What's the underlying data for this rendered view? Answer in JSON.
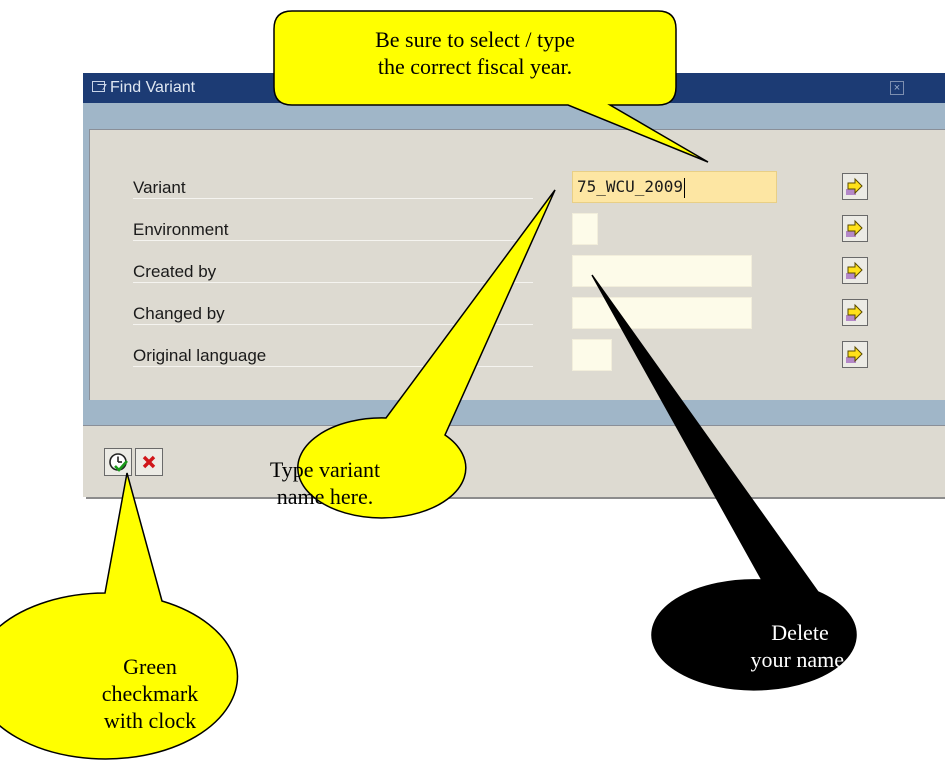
{
  "window": {
    "title": "Find Variant"
  },
  "form": {
    "variant": {
      "label": "Variant",
      "value": "75_WCU_2009"
    },
    "environment": {
      "label": "Environment",
      "value": ""
    },
    "created_by": {
      "label": "Created by",
      "value": ""
    },
    "changed_by": {
      "label": "Changed by",
      "value": ""
    },
    "original_language": {
      "label": "Original language",
      "value": ""
    }
  },
  "icons": {
    "multiple_selection": "arrow-right-icon",
    "execute": "checkmark-clock-icon",
    "cancel": "red-x-icon",
    "window": "find-window-icon",
    "close": "close-icon"
  },
  "callouts": {
    "fiscal_year": [
      "Be sure to select / type",
      "the correct fiscal year."
    ],
    "variant_name": [
      "Type variant",
      "name here."
    ],
    "delete_name": [
      "Delete",
      "your name."
    ],
    "green_check": [
      "Green",
      "checkmark",
      "with clock"
    ]
  },
  "colors": {
    "titlebar": "#1c3b74",
    "panel": "#dddad1",
    "frame": "#a0b6c8",
    "field_active": "#fde6a3",
    "field": "#fdfbe9",
    "callout_yellow": "#ffff00",
    "callout_black": "#000000"
  }
}
